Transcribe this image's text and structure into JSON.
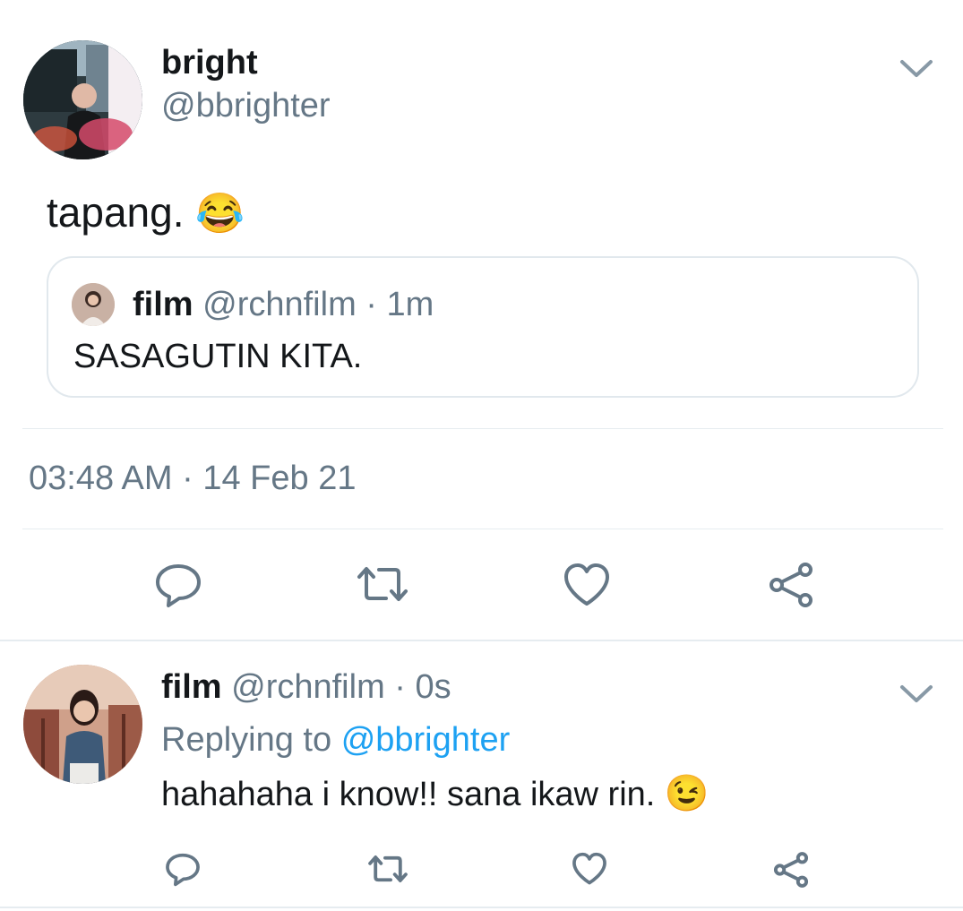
{
  "main_tweet": {
    "display_name": "bright",
    "handle": "@bbrighter",
    "text": "tapang.",
    "emoji": "😂",
    "timestamp": "03:48 AM",
    "dot": "·",
    "date": "14 Feb 21"
  },
  "quoted_tweet": {
    "display_name": "film",
    "handle": "@rchnfilm",
    "dot": "·",
    "age": "1m",
    "text": "SASAGUTIN KITA."
  },
  "reply_tweet": {
    "display_name": "film",
    "handle": "@rchnfilm",
    "dot": "·",
    "age": "0s",
    "replying_prefix": "Replying to",
    "replying_handle": "@bbrighter",
    "text": "hahahaha i know!! sana ikaw rin.",
    "emoji": "😉"
  },
  "icons": {
    "menu": "chevron-down-icon",
    "reply": "reply-icon",
    "retweet": "retweet-icon",
    "like": "heart-icon",
    "share": "share-icon"
  },
  "colors": {
    "text": "#14171a",
    "muted": "#657786",
    "link": "#1da1f2",
    "divider": "#e6ecf0"
  }
}
